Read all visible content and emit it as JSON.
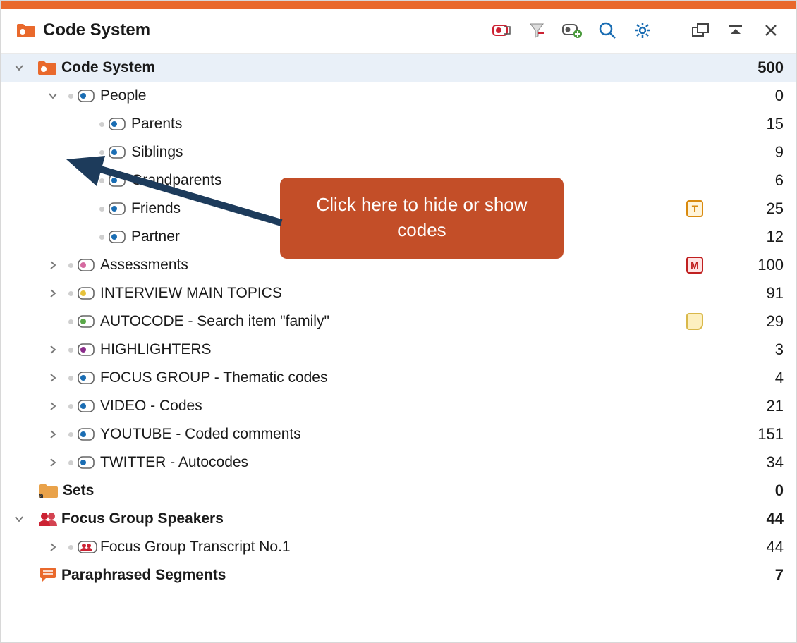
{
  "header": {
    "title": "Code System"
  },
  "callout": "Click here to hide or show codes",
  "tree": {
    "root": {
      "label": "Code System",
      "count": "500"
    },
    "people": {
      "label": "People",
      "count": "0",
      "children": {
        "parents": {
          "label": "Parents",
          "count": "15"
        },
        "siblings": {
          "label": "Siblings",
          "count": "9"
        },
        "grandparents": {
          "label": "Grandparents",
          "count": "6"
        },
        "friends": {
          "label": "Friends",
          "count": "25"
        },
        "partner": {
          "label": "Partner",
          "count": "12"
        }
      }
    },
    "assessments": {
      "label": "Assessments",
      "count": "100"
    },
    "interview": {
      "label": "INTERVIEW MAIN TOPICS",
      "count": "91"
    },
    "autocode": {
      "label": "AUTOCODE - Search item \"family\"",
      "count": "29"
    },
    "highlighters": {
      "label": "HIGHLIGHTERS",
      "count": "3"
    },
    "focusgroup": {
      "label": "FOCUS GROUP - Thematic codes",
      "count": "4"
    },
    "video": {
      "label": "VIDEO - Codes",
      "count": "21"
    },
    "youtube": {
      "label": "YOUTUBE - Coded comments",
      "count": "151"
    },
    "twitter": {
      "label": "TWITTER - Autocodes",
      "count": "34"
    },
    "sets": {
      "label": "Sets",
      "count": "0"
    },
    "focusspeakers": {
      "label": "Focus Group Speakers",
      "count": "44"
    },
    "transcript1": {
      "label": "Focus Group Transcript No.1",
      "count": "44"
    },
    "paraphrased": {
      "label": "Paraphrased Segments",
      "count": "7"
    }
  },
  "badges": {
    "T": "T",
    "M": "M"
  }
}
